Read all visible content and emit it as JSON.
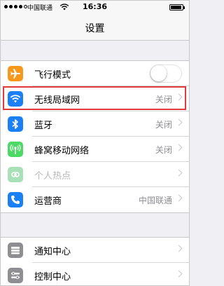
{
  "status_bar": {
    "carrier": "中国联通",
    "time": "16:36",
    "signal_bars_filled": 4,
    "signal_bars_total": 5,
    "battery_level": 0.9
  },
  "nav": {
    "title": "设置"
  },
  "group1": [
    {
      "label": "飞行模式",
      "icon": "airplane-icon",
      "icon_color": "#f7981c",
      "control": "toggle",
      "toggle_on": false
    },
    {
      "label": "无线局域网",
      "icon": "wifi-icon",
      "icon_color": "#1b7ff6",
      "value": "关闭",
      "highlighted": true
    },
    {
      "label": "蓝牙",
      "icon": "bluetooth-icon",
      "icon_color": "#1b7ff6",
      "value": "关闭"
    },
    {
      "label": "蜂窝移动网络",
      "icon": "cellular-icon",
      "icon_color": "#4cd964",
      "value": "关闭"
    },
    {
      "label": "个人热点",
      "icon": "hotspot-icon",
      "icon_color": "#a8e0b8",
      "dimmed": true
    },
    {
      "label": "运营商",
      "icon": "phone-icon",
      "icon_color": "#1b7ff6",
      "value": "中国联通"
    }
  ],
  "group2": [
    {
      "label": "通知中心",
      "icon": "notification-center-icon",
      "icon_color": "#8e8e93"
    },
    {
      "label": "控制中心",
      "icon": "control-center-icon",
      "icon_color": "#8e8e93"
    }
  ],
  "highlight_color": "#e03a3a"
}
